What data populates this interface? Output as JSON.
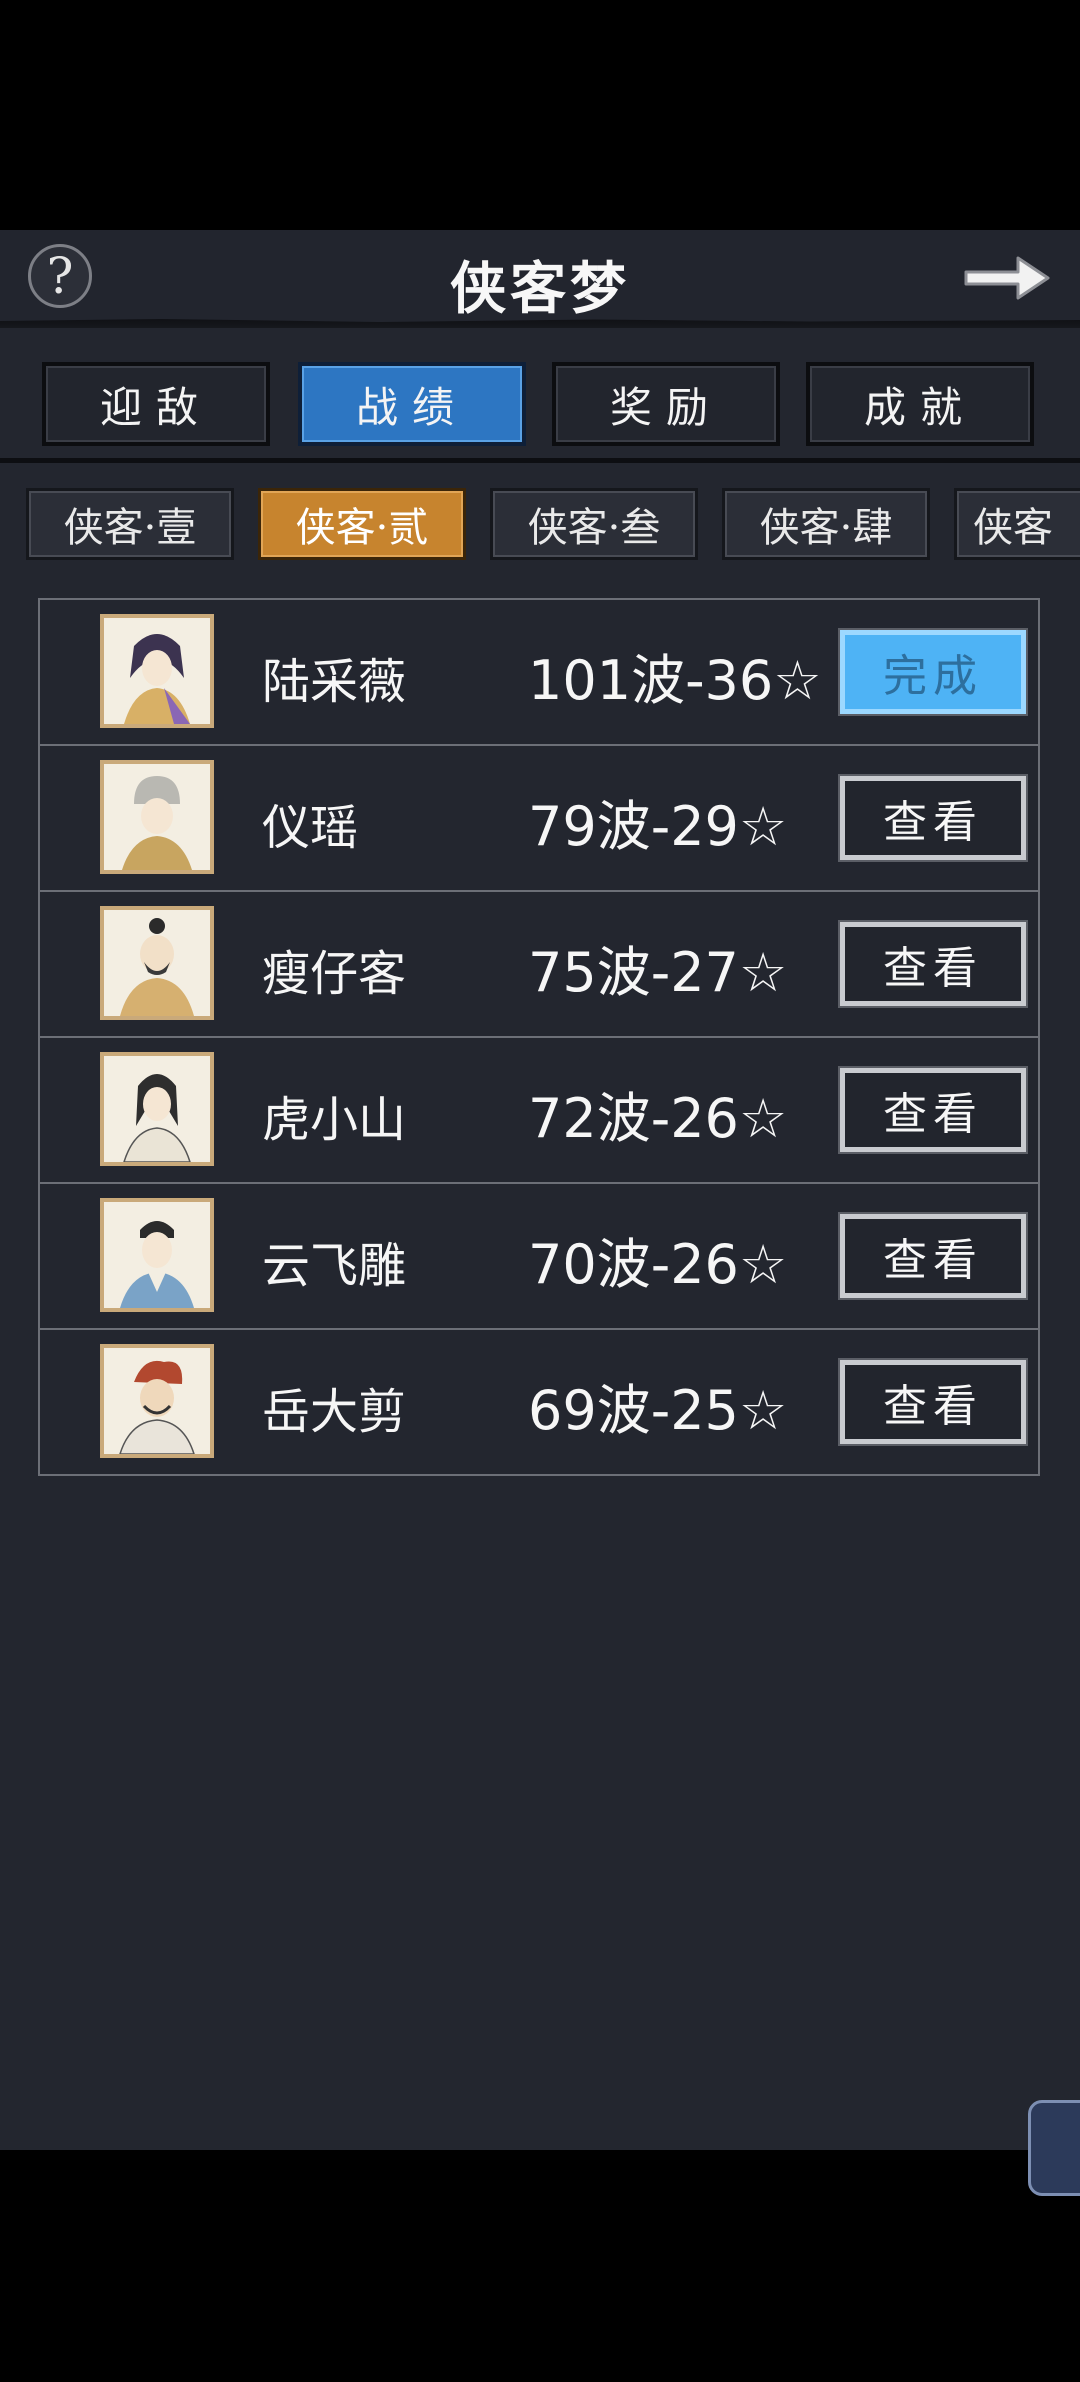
{
  "header": {
    "title": "侠客梦",
    "help_label": "?"
  },
  "main_tabs": [
    {
      "label": "迎敌",
      "active": false
    },
    {
      "label": "战绩",
      "active": true
    },
    {
      "label": "奖励",
      "active": false
    },
    {
      "label": "成就",
      "active": false
    }
  ],
  "sub_tabs": [
    {
      "label": "侠客·壹",
      "active": false
    },
    {
      "label": "侠客·贰",
      "active": true
    },
    {
      "label": "侠客·叁",
      "active": false
    },
    {
      "label": "侠客·肆",
      "active": false
    },
    {
      "label": "侠客",
      "active": false
    }
  ],
  "rows": [
    {
      "name": "陆采薇",
      "record": "101波-36☆",
      "button": "完成",
      "state": "done"
    },
    {
      "name": "仪瑶",
      "record": "79波-29☆",
      "button": "查看",
      "state": "view"
    },
    {
      "name": "瘦仔客",
      "record": "75波-27☆",
      "button": "查看",
      "state": "view"
    },
    {
      "name": "虎小山",
      "record": "72波-26☆",
      "button": "查看",
      "state": "view"
    },
    {
      "name": "云飞雕",
      "record": "70波-26☆",
      "button": "查看",
      "state": "view"
    },
    {
      "name": "岳大剪",
      "record": "69波-25☆",
      "button": "查看",
      "state": "view"
    }
  ],
  "colors": {
    "background": "#23262f",
    "active_tab": "#2d76c2",
    "active_subtab": "#c7842e",
    "done_button": "#4eb3f5"
  }
}
